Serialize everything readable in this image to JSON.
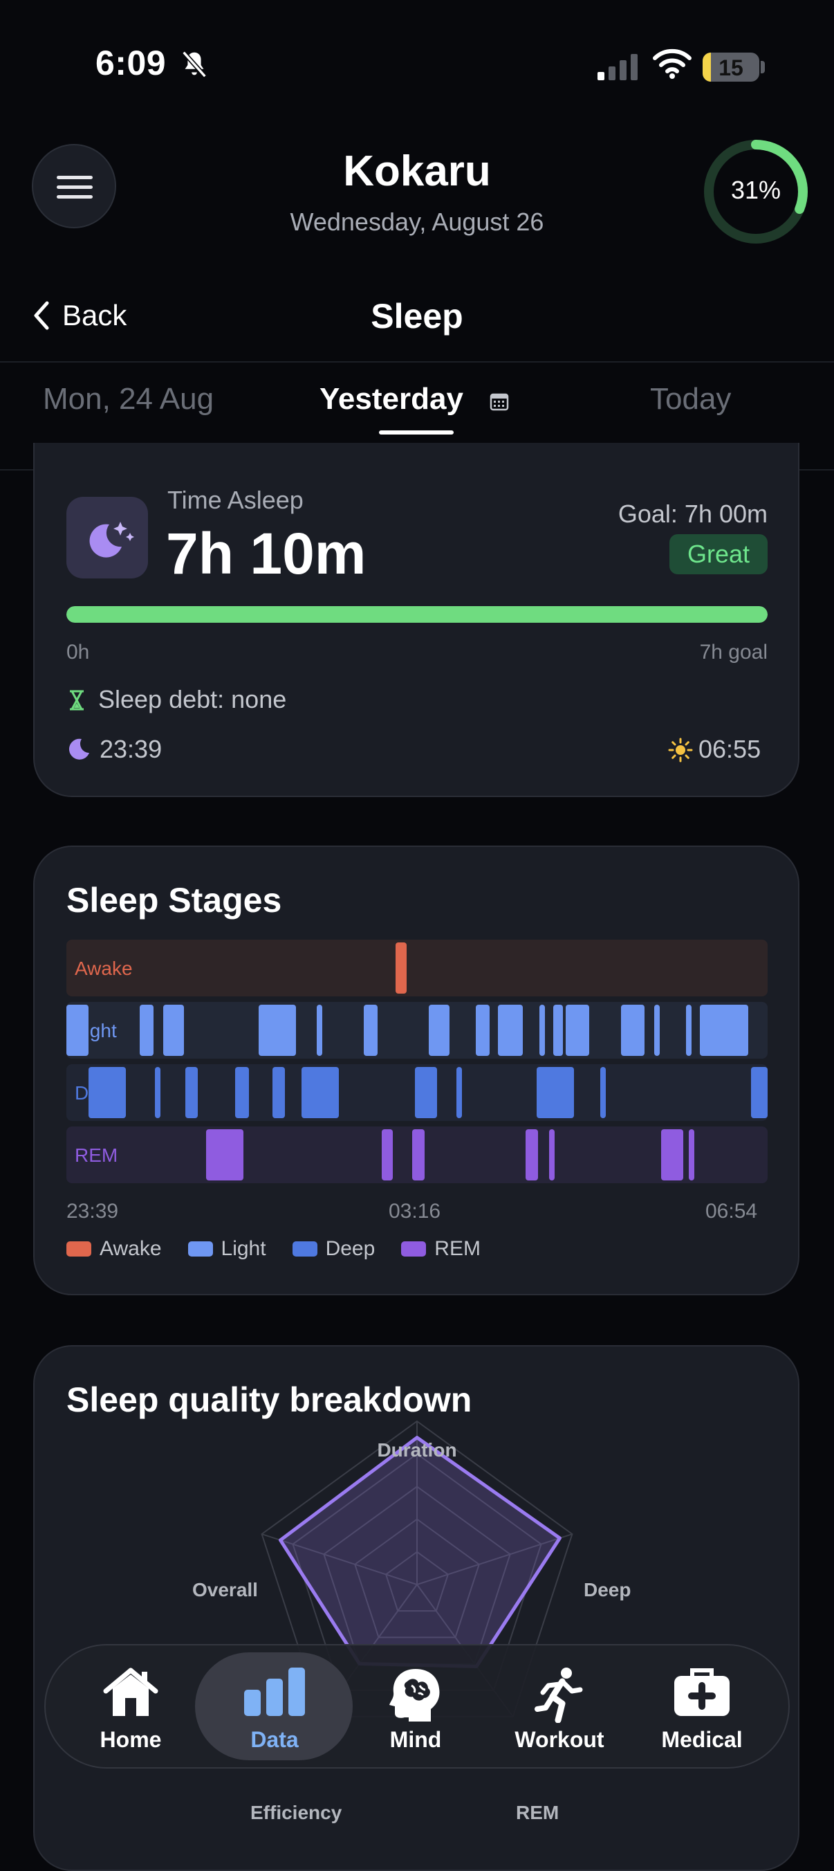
{
  "status_bar": {
    "time": "6:09",
    "battery": "15"
  },
  "header": {
    "title": "Kokaru",
    "date": "Wednesday, August 26",
    "ring_percent": 31,
    "ring_label": "31%"
  },
  "nav": {
    "back_label": "Back",
    "page_title": "Sleep"
  },
  "date_tabs": {
    "prev": "Mon, 24 Aug",
    "current": "Yesterday",
    "next": "Today"
  },
  "time_asleep": {
    "label": "Time Asleep",
    "value": "7h 10m",
    "goal_label": "Goal: 7h 00m",
    "badge": "Great",
    "progress": 1.0,
    "scale_min": "0h",
    "scale_max": "7h goal",
    "debt": "Sleep debt: none",
    "bed_time": "23:39",
    "wake_time": "06:55",
    "colors": {
      "accent": "#6fdc80",
      "badge_bg": "#1f4d36"
    }
  },
  "sleep_stages": {
    "title": "Sleep Stages",
    "lanes": [
      "Awake",
      "Light",
      "Deep",
      "REM"
    ],
    "axis": [
      "23:39",
      "03:16",
      "06:54"
    ],
    "legend": [
      "Awake",
      "Light",
      "Deep",
      "REM"
    ],
    "colors": {
      "Awake": "#e0674d",
      "Light": "#6f97f2",
      "Deep": "#4f79e0",
      "REM": "#8f5ce0"
    }
  },
  "quality": {
    "title": "Sleep quality breakdown",
    "axes": [
      "Duration",
      "Deep",
      "REM",
      "Efficiency",
      "Overall"
    ],
    "values": [
      0.9,
      0.92,
      0.62,
      0.6,
      0.88
    ],
    "color": "#9a7bf0"
  },
  "bottom_nav": [
    {
      "label": "Home",
      "icon": "house-icon"
    },
    {
      "label": "Data",
      "icon": "bar-chart-icon",
      "active": true
    },
    {
      "label": "Mind",
      "icon": "brain-head-icon"
    },
    {
      "label": "Workout",
      "icon": "running-icon"
    },
    {
      "label": "Medical",
      "icon": "first-aid-kit-icon"
    }
  ]
}
